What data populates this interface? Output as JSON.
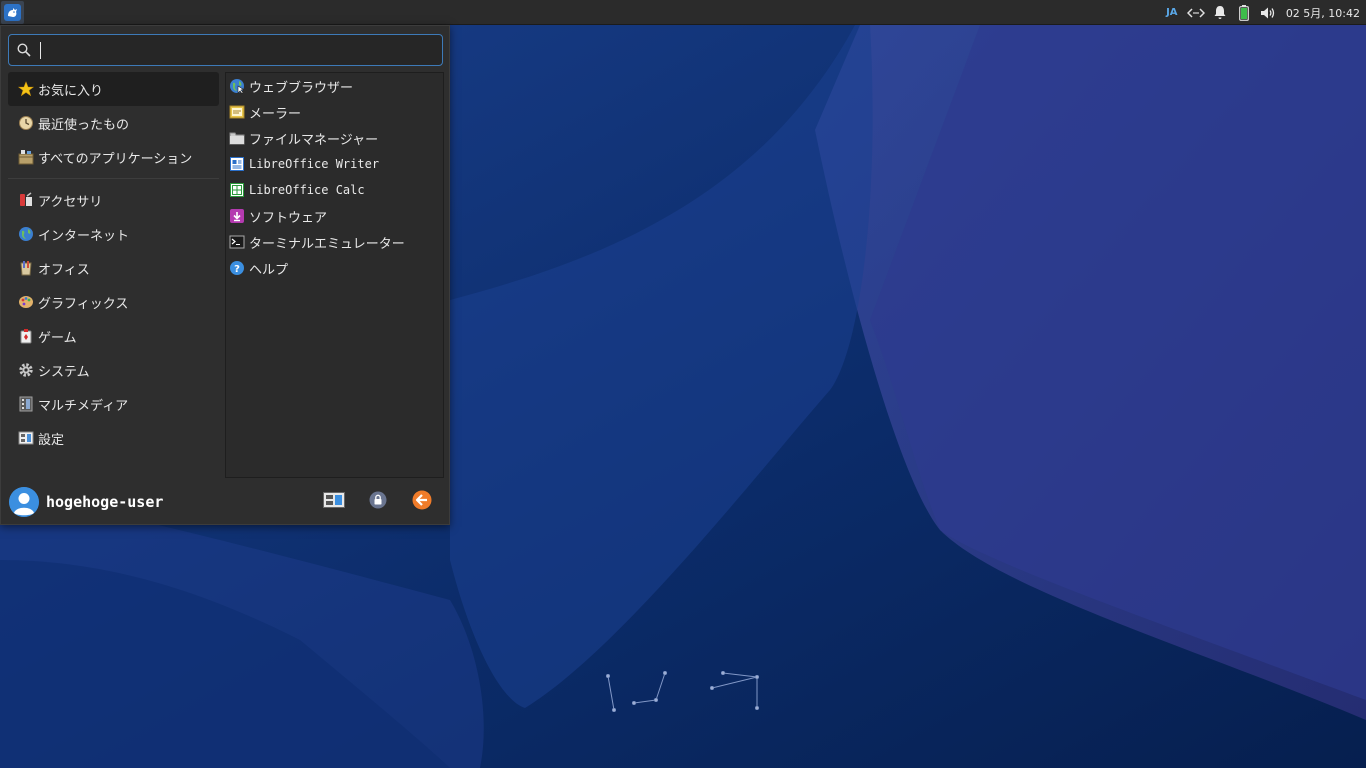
{
  "colors": {
    "panel_bg": "#2b2b2b",
    "menu_bg": "#2e2e2e",
    "accent": "#3d7ab8",
    "desktop_bg": "#0d2a63"
  },
  "top_panel": {
    "keyboard_layout": "JA",
    "clock": "02 5月, 10:42",
    "icons": [
      "whisker-menu-icon",
      "network-icon",
      "bell-icon",
      "battery-icon",
      "volume-icon"
    ]
  },
  "search": {
    "value": "",
    "placeholder": ""
  },
  "categories": [
    {
      "label": "お気に入り",
      "icon": "star-icon",
      "active": true
    },
    {
      "label": "最近使ったもの",
      "icon": "recent-icon"
    },
    {
      "label": "すべてのアプリケーション",
      "icon": "all-apps-icon"
    },
    {
      "label": "アクセサリ",
      "icon": "accessories-icon"
    },
    {
      "label": "インターネット",
      "icon": "internet-icon"
    },
    {
      "label": "オフィス",
      "icon": "office-icon"
    },
    {
      "label": "グラフィックス",
      "icon": "graphics-icon"
    },
    {
      "label": "ゲーム",
      "icon": "game-icon"
    },
    {
      "label": "システム",
      "icon": "system-gear-icon"
    },
    {
      "label": "マルチメディア",
      "icon": "multimedia-icon"
    },
    {
      "label": "設定",
      "icon": "settings-icon"
    }
  ],
  "apps": [
    {
      "label": "ウェブブラウザー",
      "icon": "web-browser-icon"
    },
    {
      "label": "メーラー",
      "icon": "mail-icon"
    },
    {
      "label": "ファイルマネージャー",
      "icon": "folder-icon"
    },
    {
      "label": "LibreOffice Writer",
      "icon": "writer-icon"
    },
    {
      "label": "LibreOffice Calc",
      "icon": "calc-icon"
    },
    {
      "label": "ソフトウェア",
      "icon": "software-icon"
    },
    {
      "label": "ターミナルエミュレーター",
      "icon": "terminal-icon"
    },
    {
      "label": "ヘルプ",
      "icon": "help-icon"
    }
  ],
  "footer": {
    "user": "hogehoge-user",
    "buttons": [
      "settings-manager-icon",
      "lock-icon",
      "logout-icon"
    ]
  }
}
